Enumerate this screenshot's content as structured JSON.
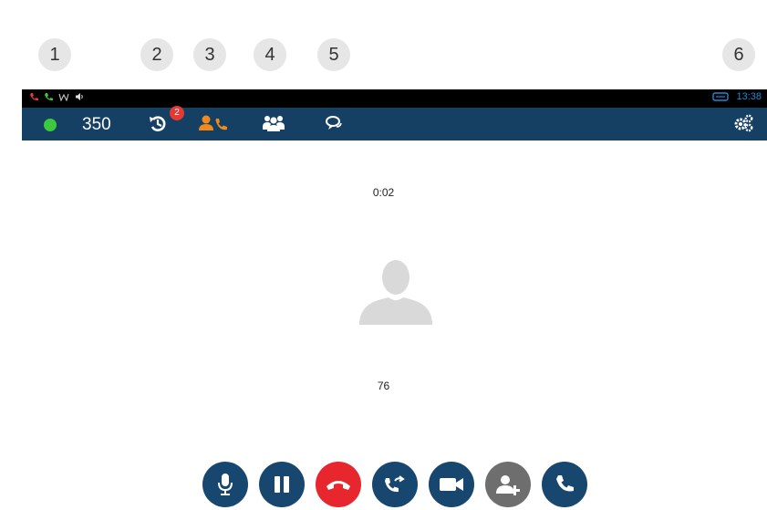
{
  "callouts": [
    "1",
    "2",
    "3",
    "4",
    "5",
    "6"
  ],
  "statusbar": {
    "time": "13:38",
    "icons": [
      "missed-call-icon",
      "call-icon",
      "wifi-icon",
      "volume-icon",
      "voicemail-icon"
    ]
  },
  "navbar": {
    "presence_color": "#3ec83e",
    "extension": "350",
    "history_badge": "2",
    "tabs": [
      "history-icon",
      "contacts-icon",
      "conference-icon",
      "chat-icon"
    ],
    "settings_icon": "settings-icon"
  },
  "call": {
    "duration": "0:02",
    "caller": "76"
  },
  "controls": [
    "mute-button",
    "hold-button",
    "hangup-button",
    "transfer-button",
    "video-button",
    "add-participant-button",
    "dialpad-call-button"
  ],
  "colors": {
    "navbar": "#153f63",
    "control": "#17466e",
    "hangup": "#e8262e",
    "accent_orange": "#f08a1c",
    "presence": "#3ec83e"
  }
}
